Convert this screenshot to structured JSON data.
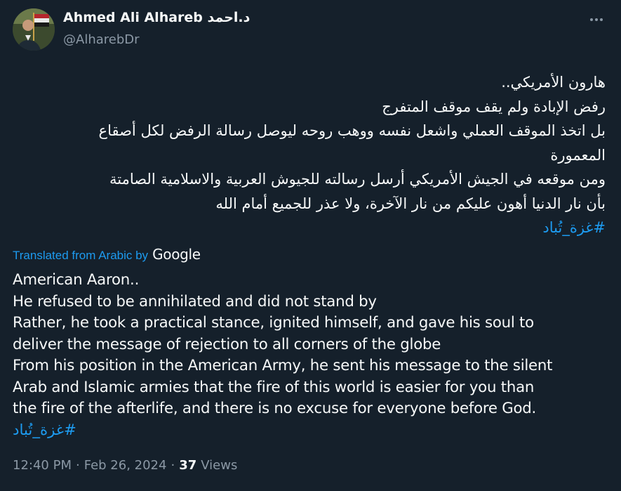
{
  "author": {
    "display_name": "Ahmed Ali Alhareb د.احمد",
    "handle": "@AlharebDr",
    "avatar_icon": "profile-photo-with-flag"
  },
  "menu": {
    "more_icon": "more-horizontal-icon"
  },
  "tweet_text": {
    "line1": "هارون الأمريكي..",
    "line2": "رفض الإبادة ولم يقف موقف المتفرج",
    "line3": "بل اتخذ الموقف العملي واشعل نفسه ووهب روحه ليوصل رسالة الرفض لكل أصقاع",
    "line4": "المعمورة",
    "line5": "ومن موقعه في الجيش الأمريكي أرسل رسالته للجيوش العربية والاسلامية الصامتة",
    "line6": "بأن نار الدنيا أهون عليكم من نار الآخرة، ولا عذر للجميع أمام الله",
    "hashtag": "#غزة_تُباد"
  },
  "translation": {
    "label": "Translated from Arabic by",
    "provider": "Google",
    "line1": "American Aaron..",
    "line2": "He refused to be annihilated and did not stand by",
    "line3": "Rather, he took a practical stance, ignited himself, and gave his soul to",
    "line4": "deliver the message of rejection to all corners of the globe",
    "line5": "From his position in the American Army, he sent his message to the silent",
    "line6": "Arab and Islamic armies that the fire of this world is easier for you than",
    "line7": "the fire of the afterlife, and there is no excuse for everyone before God.",
    "hashtag": "#غزة_تُباد"
  },
  "meta": {
    "time": "12:40 PM",
    "separator": "·",
    "date": "Feb 26, 2024",
    "views_count": "37",
    "views_label": "Views"
  },
  "colors": {
    "background": "#15202b",
    "text": "#f7f9f9",
    "secondary": "#8b98a5",
    "accent": "#1d9bf0"
  }
}
